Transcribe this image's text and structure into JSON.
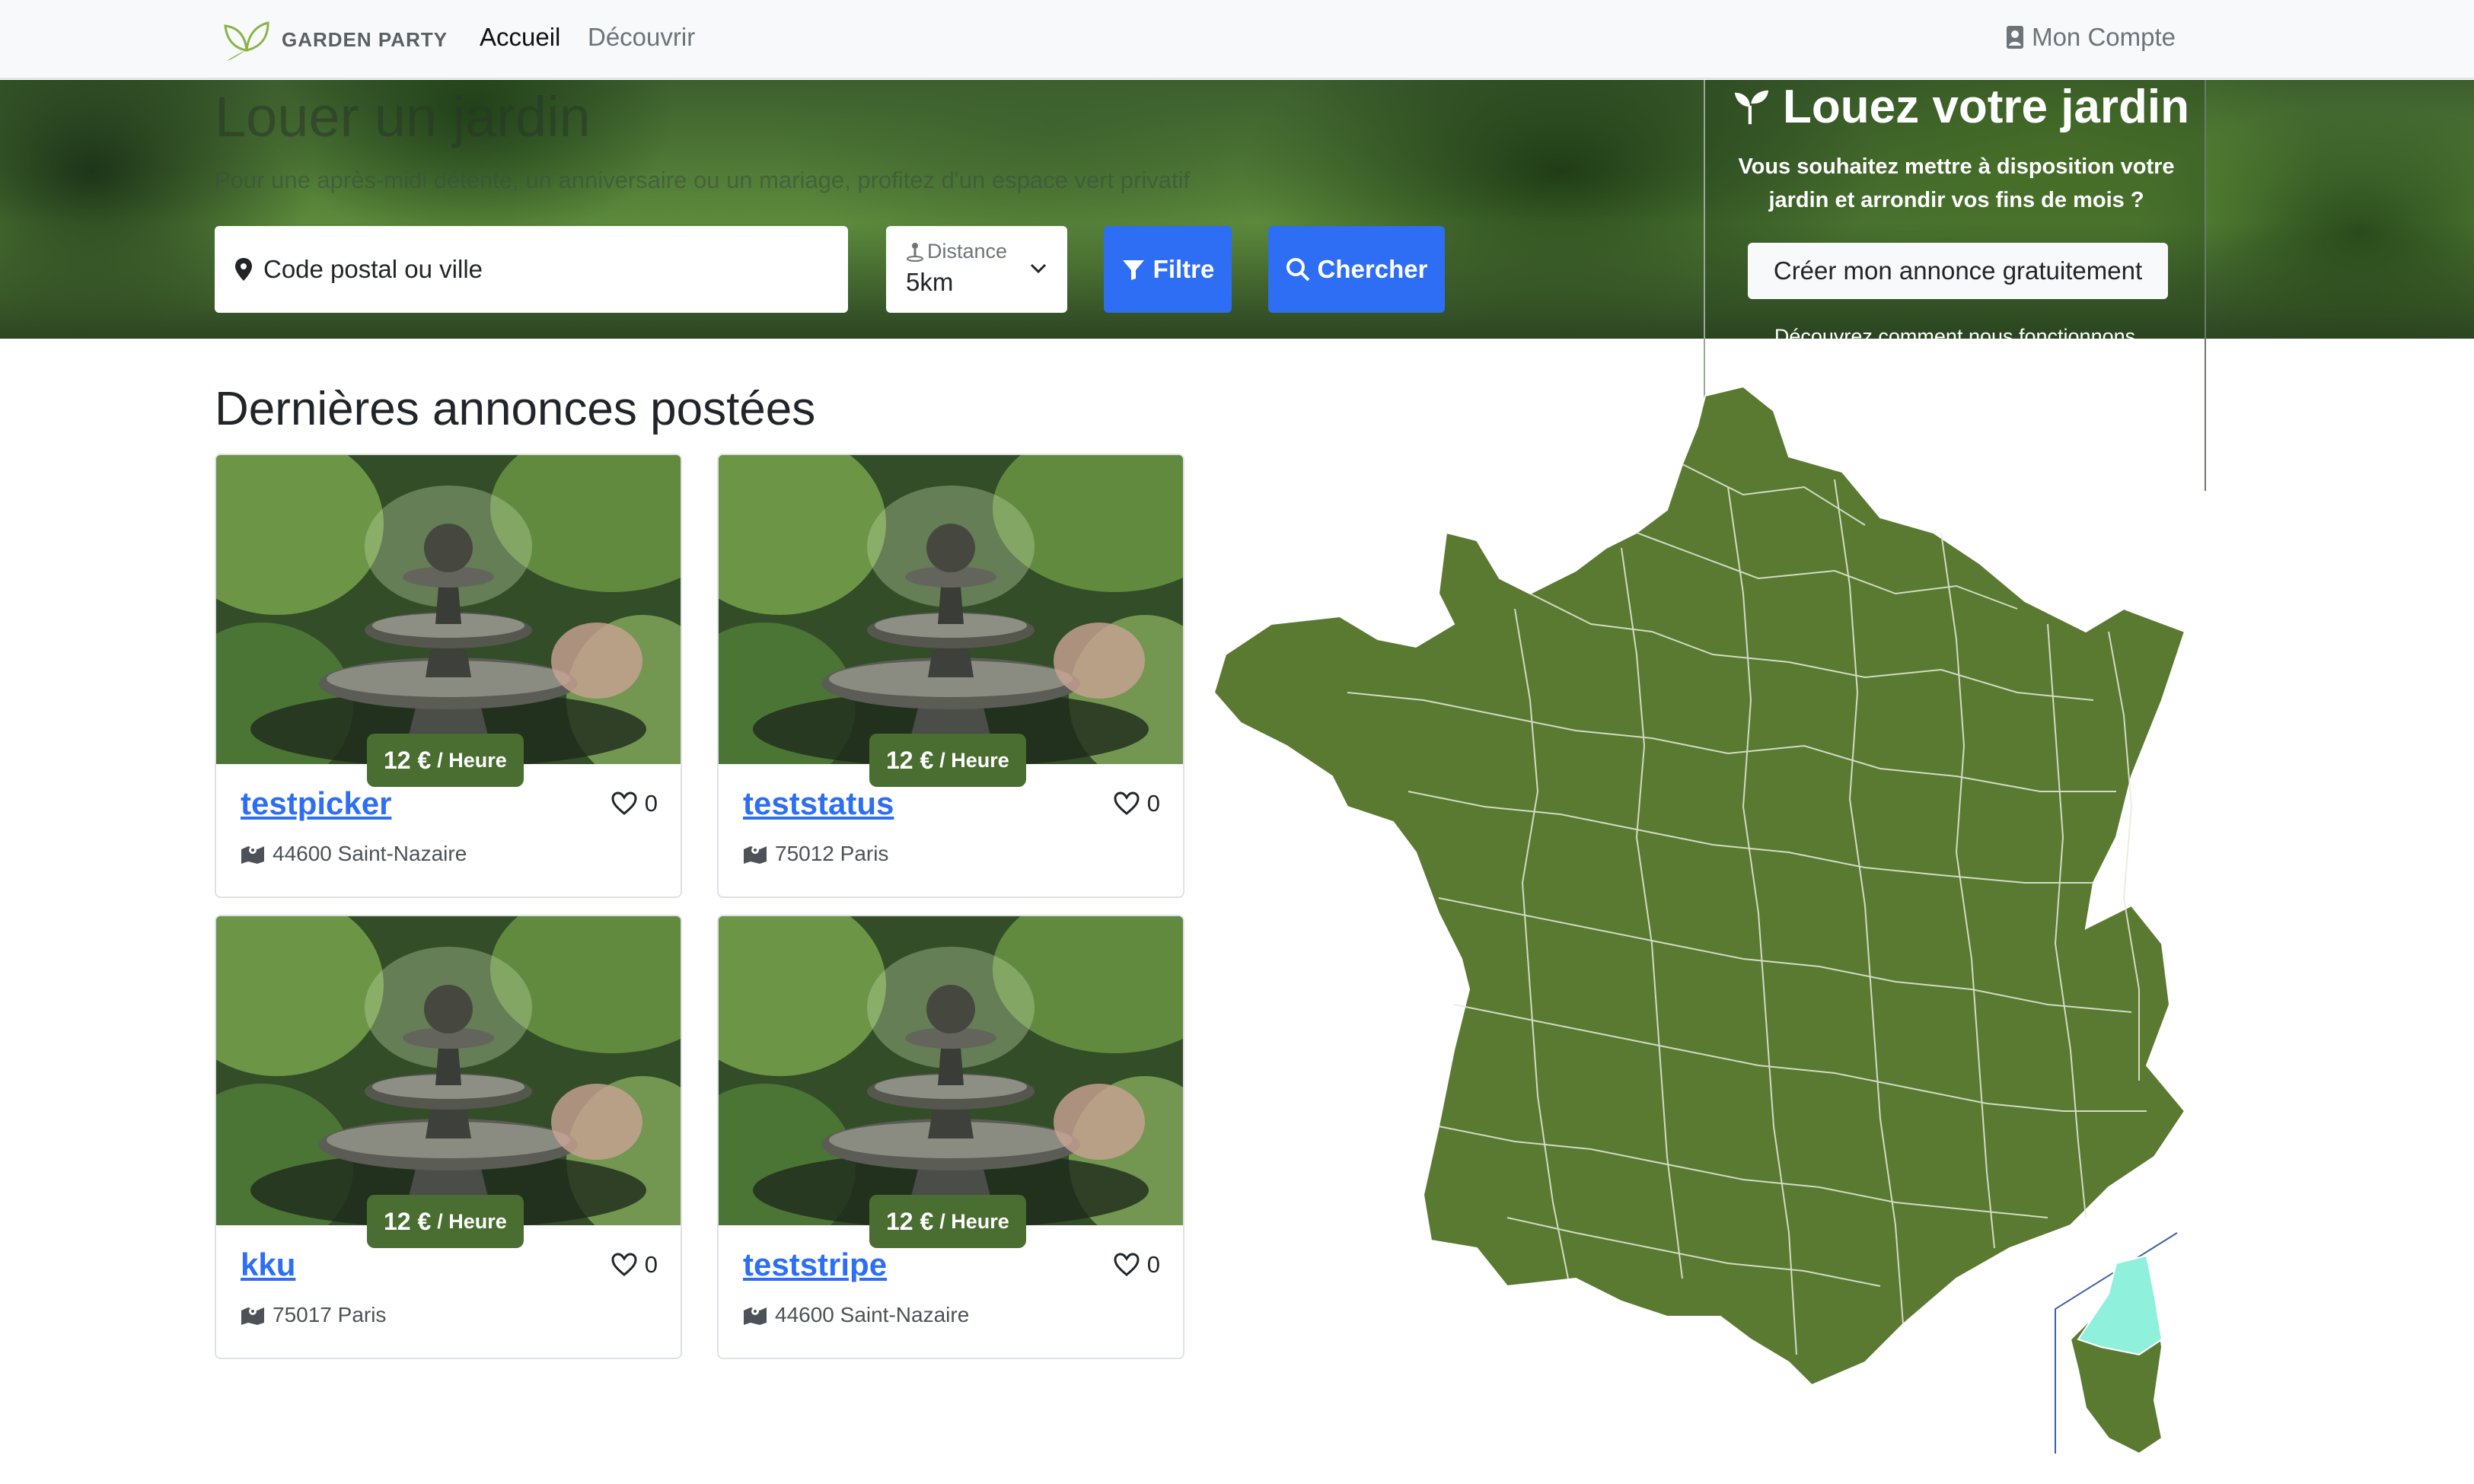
{
  "navbar": {
    "brand": "GARDEN PARTY",
    "links": [
      "Accueil",
      "Découvrir"
    ],
    "account": "Mon Compte"
  },
  "hero": {
    "title": "Louer un jardin",
    "subtitle": "Pour une après-midi détente, un anniversaire ou un mariage, profitez d'un espace vert privatif",
    "search_placeholder": "Code postal ou ville",
    "distance_label": "Distance",
    "distance_value": "5km",
    "filter_label": "Filtre",
    "search_label": "Chercher"
  },
  "panel": {
    "title": "Louez votre jardin",
    "text": "Vous souhaitez mettre à disposition votre jardin et arrondir vos fins de mois ?",
    "button": "Créer mon annonce gratuitement",
    "link": "Découvrez comment nous fonctionnons"
  },
  "section": {
    "title": "Dernières annonces postées"
  },
  "listings": [
    {
      "title": "testpicker",
      "price": "12 €",
      "unit": "/ Heure",
      "likes": "0",
      "location": "44600 Saint-Nazaire"
    },
    {
      "title": "teststatus",
      "price": "12 €",
      "unit": "/ Heure",
      "likes": "0",
      "location": "75012 Paris"
    },
    {
      "title": "kku",
      "price": "12 €",
      "unit": "/ Heure",
      "likes": "0",
      "location": "75017 Paris"
    },
    {
      "title": "teststripe",
      "price": "12 €",
      "unit": "/ Heure",
      "likes": "0",
      "location": "44600 Saint-Nazaire"
    }
  ],
  "colors": {
    "primary": "#2d6ef5",
    "brand_green": "#4a6e32",
    "map_green": "#5a7a32",
    "map_highlight": "#8ff0dc"
  }
}
